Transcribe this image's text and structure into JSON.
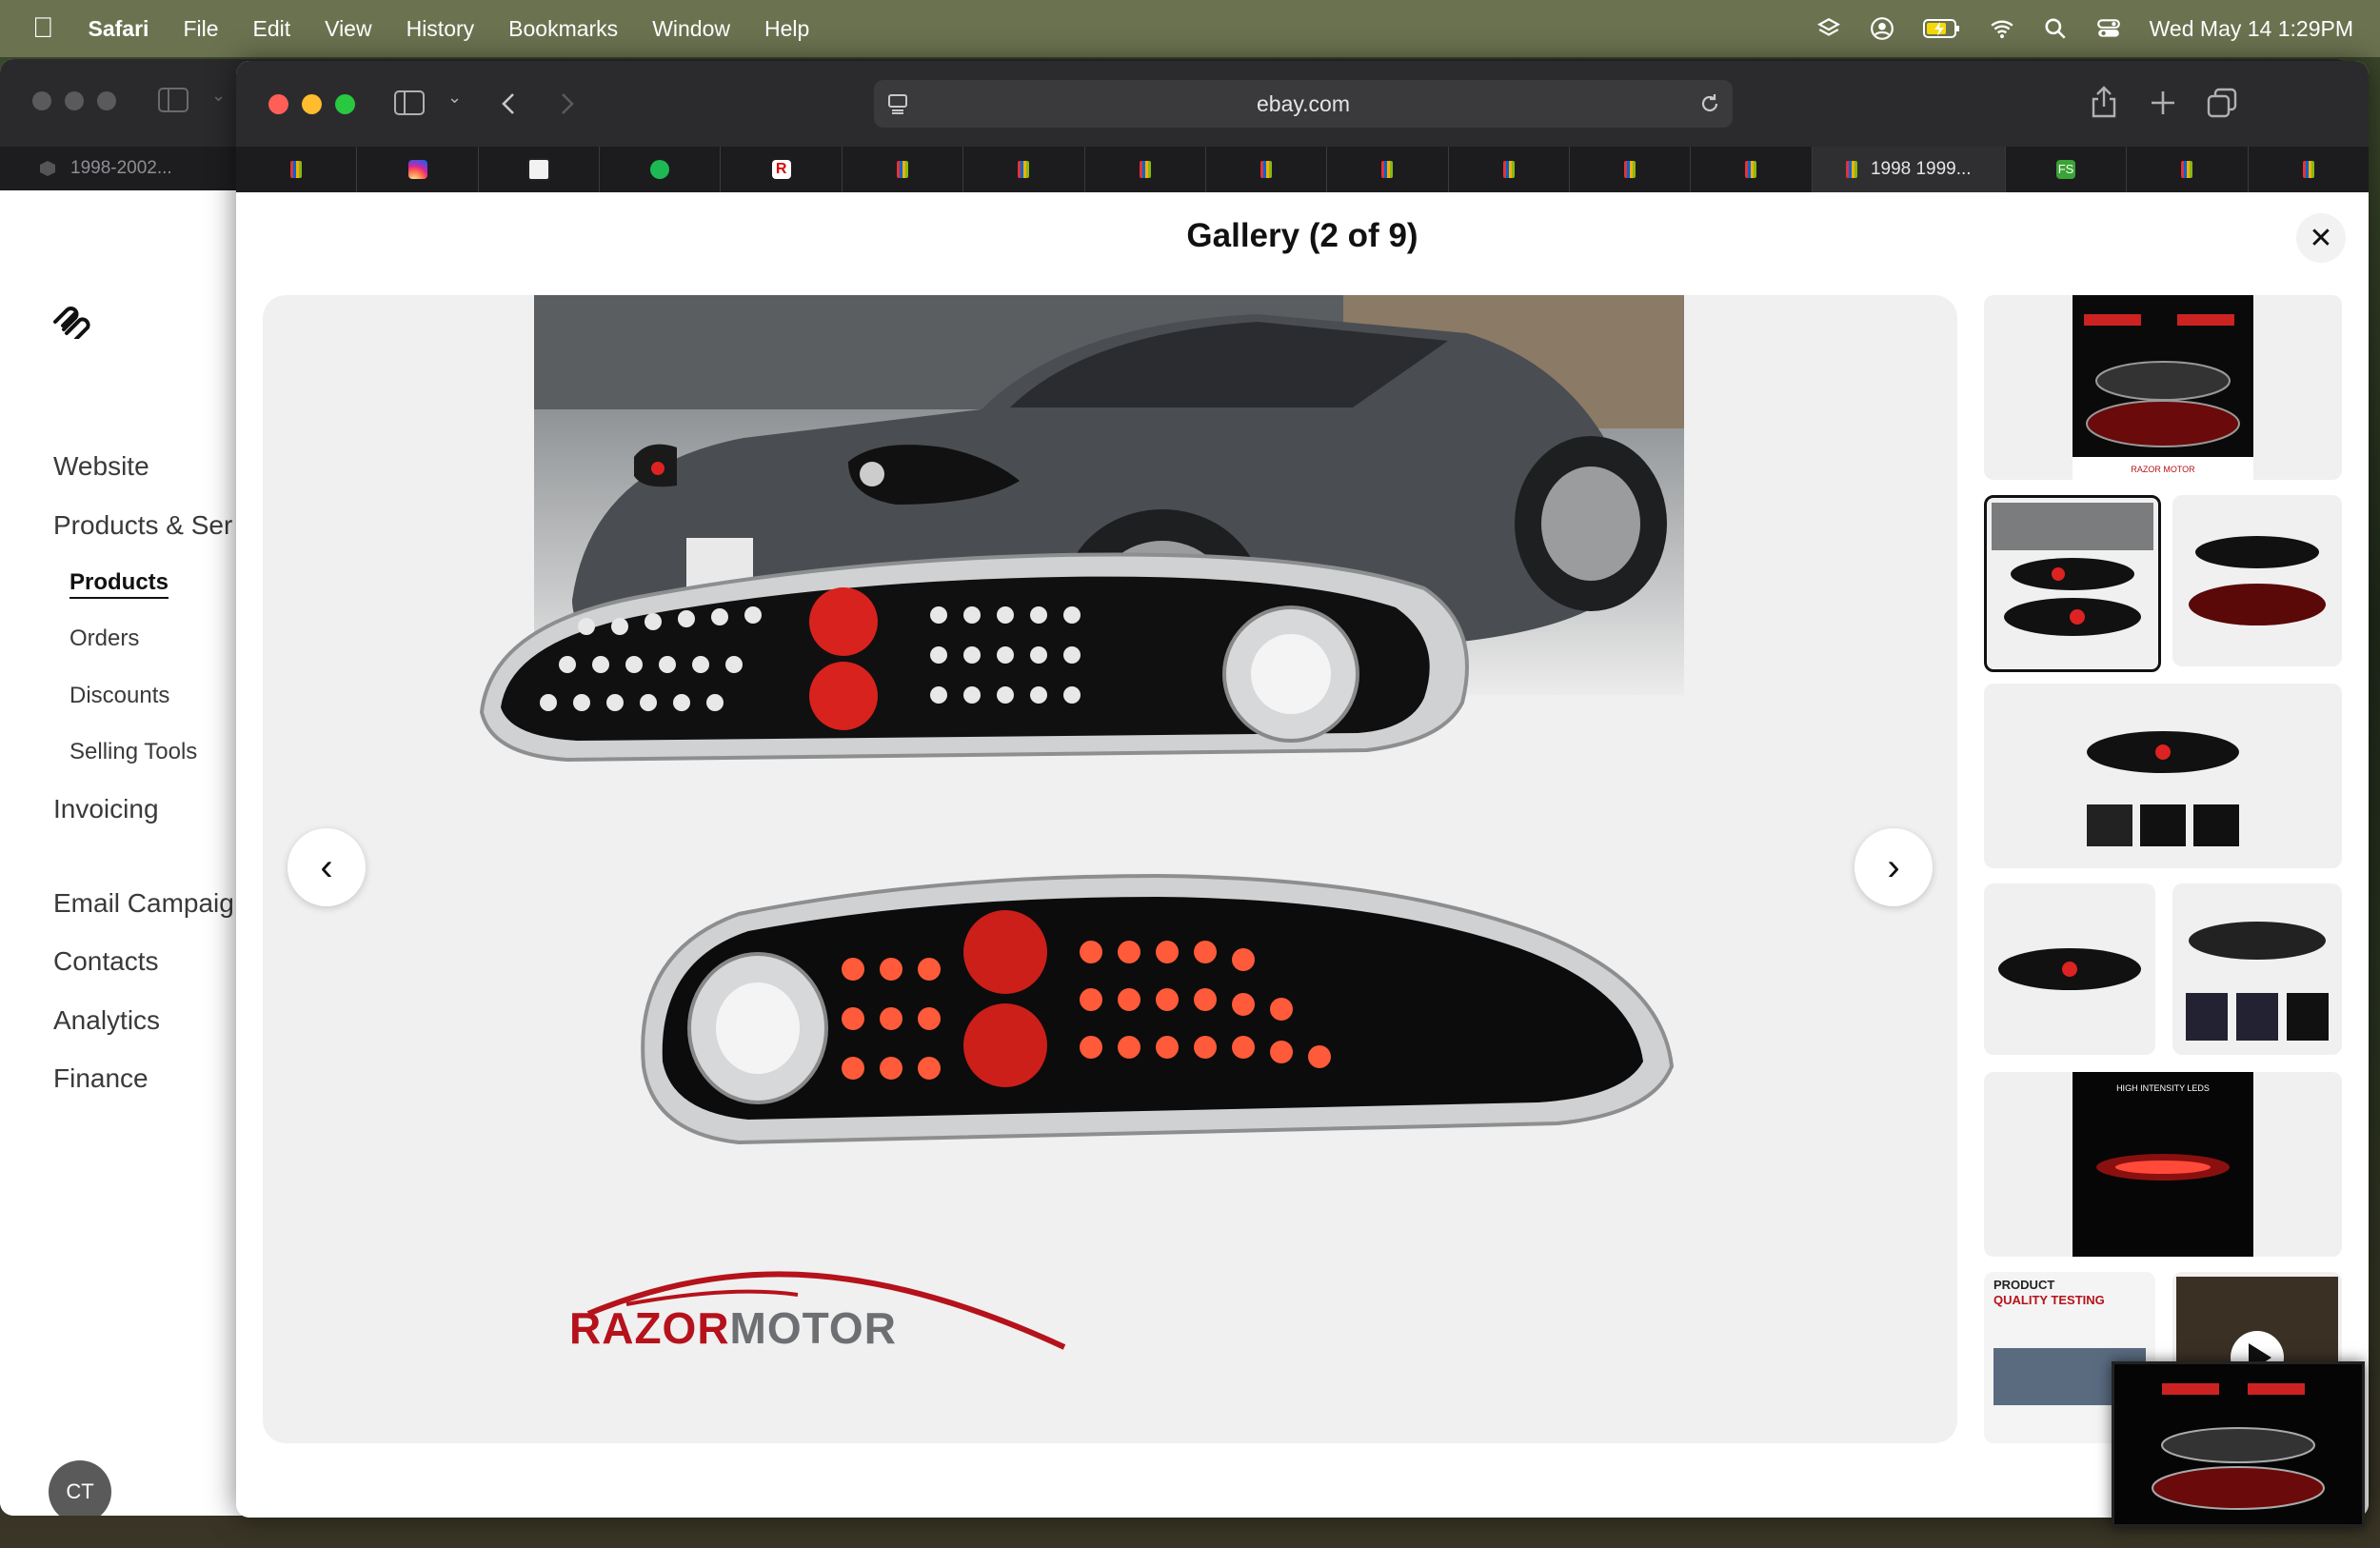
{
  "menubar": {
    "app": "Safari",
    "menus": [
      "File",
      "Edit",
      "View",
      "History",
      "Bookmarks",
      "Window",
      "Help"
    ],
    "datetime": "Wed May 14  1:29PM"
  },
  "back_window": {
    "tab_title": "1998-2002...",
    "sidebar": {
      "website": "Website",
      "products_services": "Products & Ser",
      "products": "Products",
      "orders": "Orders",
      "discounts": "Discounts",
      "selling_tools": "Selling Tools",
      "invoicing": "Invoicing",
      "email_campaigns": "Email Campaig",
      "contacts": "Contacts",
      "analytics": "Analytics",
      "finance": "Finance"
    },
    "avatar_initials": "CT"
  },
  "safari": {
    "url": "ebay.com",
    "active_tab_title": "1998 1999..."
  },
  "gallery": {
    "title": "Gallery (2 of 9)",
    "logo_text_red": "RAZOR",
    "logo_text_grey": "MOTOR",
    "thumb_texts": {
      "high_intensity": "HIGH INTENSITY LEDS",
      "product": "PRODUCT",
      "quality_testing": "QUALITY TESTING",
      "small_logo": "RAZOR MOTOR"
    }
  },
  "colors": {
    "accent_red": "#d01c1c",
    "menubar": "#6b7250",
    "safari_toolbar": "#2b2b2d"
  }
}
